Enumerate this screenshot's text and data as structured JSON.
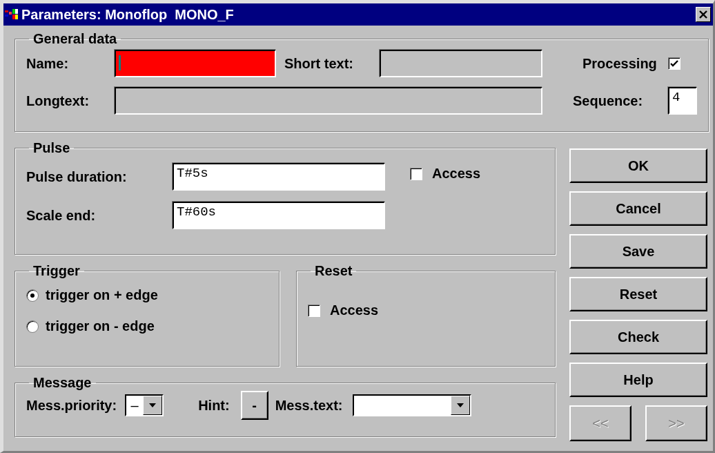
{
  "window": {
    "title": "Parameters: Monoflop  MONO_F"
  },
  "general": {
    "title": "General data",
    "name": {
      "label": "Name:",
      "invalid": true,
      "focused": true
    },
    "short_text": {
      "label": "Short text:"
    },
    "processing": {
      "label": "Processing",
      "checked": true
    },
    "longtext": {
      "label": "Longtext:"
    },
    "sequence": {
      "label": "Sequence:",
      "value": "4"
    }
  },
  "pulse": {
    "title": "Pulse",
    "fields": [
      {
        "label": "Pulse duration:",
        "value": "T#5s"
      },
      {
        "label": "Scale end:",
        "value": "T#60s"
      }
    ],
    "access": {
      "label": "Access",
      "checked": false
    }
  },
  "trigger": {
    "title": "Trigger",
    "options": [
      {
        "label": "trigger on + edge",
        "selected": true
      },
      {
        "label": "trigger on - edge",
        "selected": false
      }
    ]
  },
  "reset": {
    "title": "Reset",
    "access": {
      "label": "Access",
      "checked": false
    }
  },
  "message": {
    "title": "Message",
    "priority": {
      "label": "Mess.priority:",
      "value": "–"
    },
    "hint": {
      "label": "Hint:",
      "button": "-"
    },
    "text": {
      "label": "Mess.text:"
    }
  },
  "buttons": [
    {
      "label": "OK",
      "disabled": false
    },
    {
      "label": "Cancel",
      "disabled": false
    },
    {
      "label": "Save",
      "disabled": false
    },
    {
      "label": "Reset",
      "disabled": false
    },
    {
      "label": "Check",
      "disabled": false
    },
    {
      "label": "Help",
      "disabled": false
    }
  ],
  "nav": [
    {
      "label": "<<",
      "disabled": true
    },
    {
      "label": ">>",
      "disabled": true
    }
  ]
}
